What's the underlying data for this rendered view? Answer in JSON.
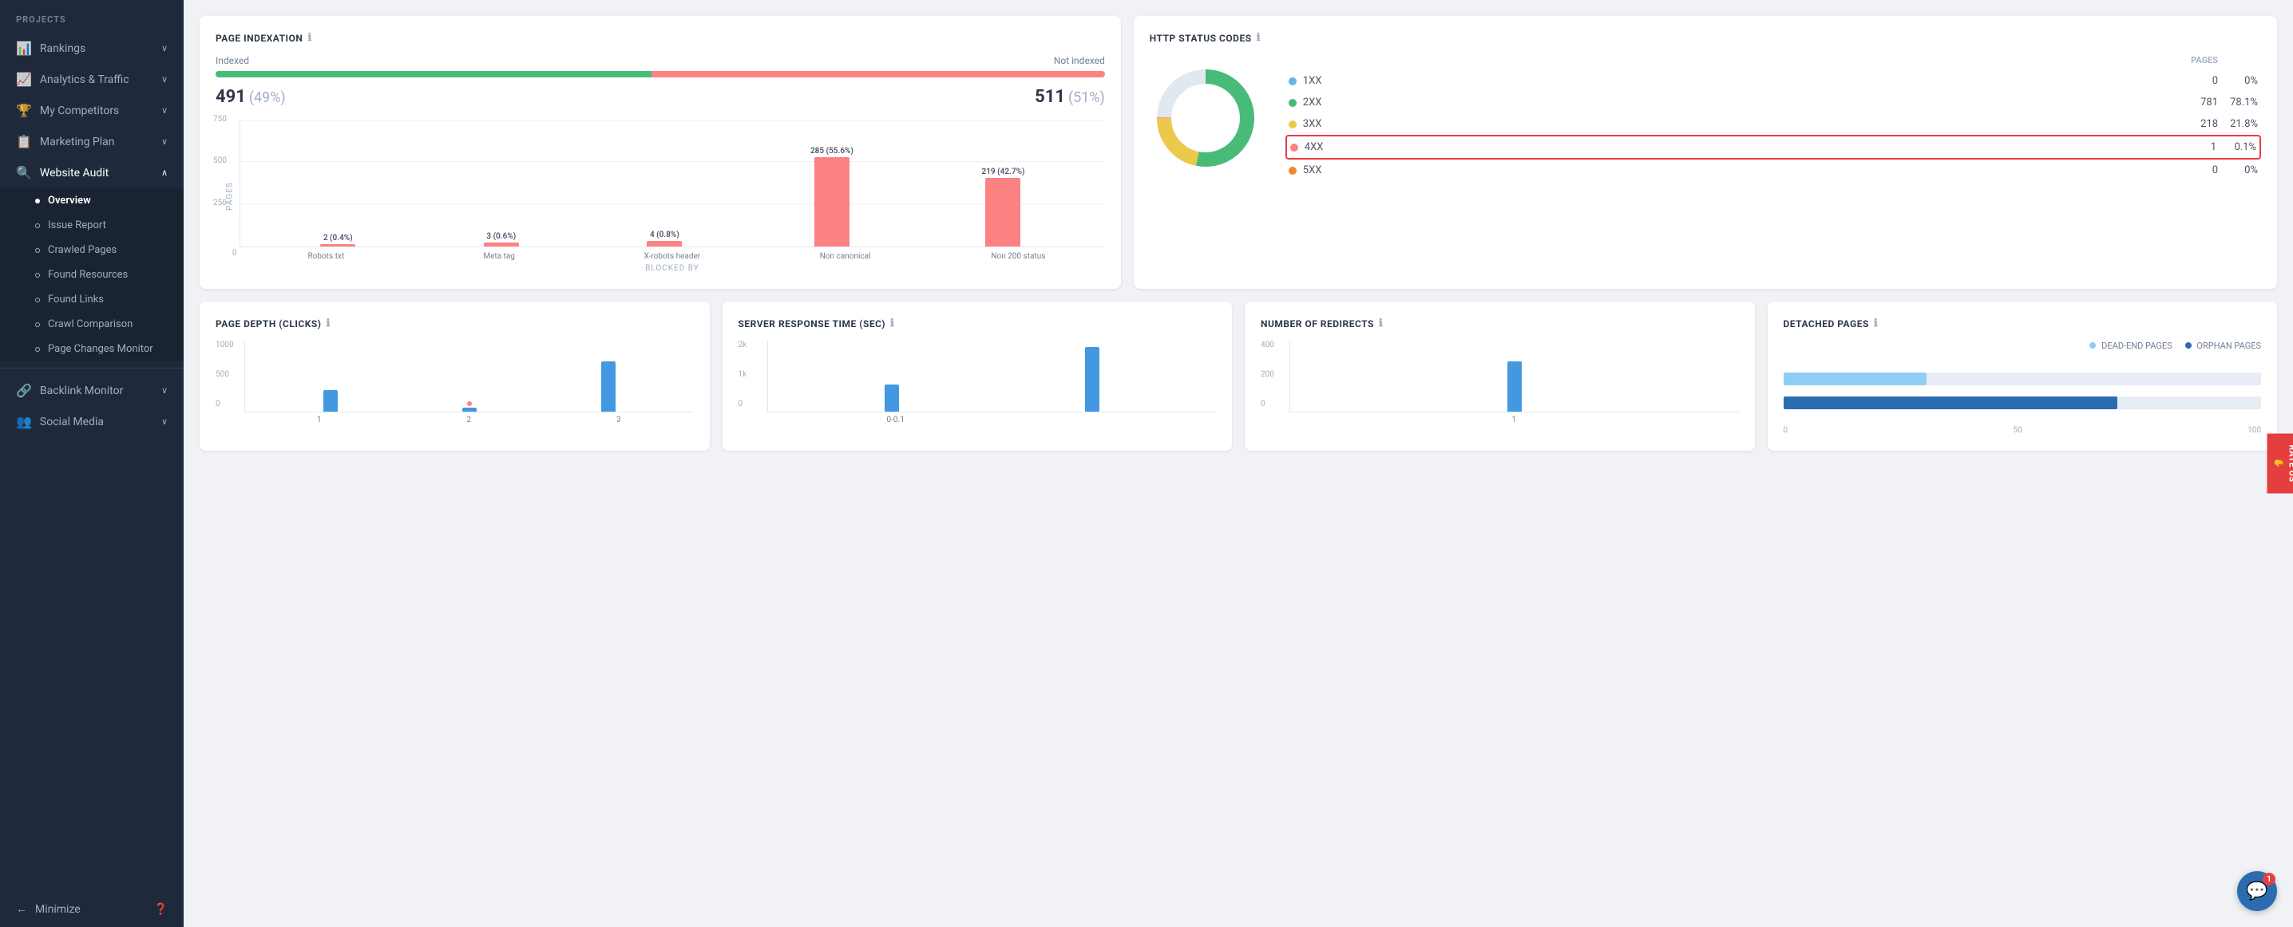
{
  "sidebar": {
    "projects_label": "PROJECTS",
    "items": [
      {
        "id": "rankings",
        "label": "Rankings",
        "icon": "📊",
        "has_chevron": true
      },
      {
        "id": "analytics",
        "label": "Analytics & Traffic",
        "icon": "📈",
        "has_chevron": true
      },
      {
        "id": "competitors",
        "label": "My Competitors",
        "icon": "🏆",
        "has_chevron": true
      },
      {
        "id": "marketing",
        "label": "Marketing Plan",
        "icon": "📋",
        "has_chevron": true
      },
      {
        "id": "website-audit",
        "label": "Website Audit",
        "icon": "🔍",
        "has_chevron": true,
        "active": true
      }
    ],
    "website_audit_subitems": [
      {
        "id": "overview",
        "label": "Overview",
        "active": true
      },
      {
        "id": "issue-report",
        "label": "Issue Report"
      },
      {
        "id": "crawled-pages",
        "label": "Crawled Pages"
      },
      {
        "id": "found-resources",
        "label": "Found Resources"
      },
      {
        "id": "found-links",
        "label": "Found Links"
      },
      {
        "id": "crawl-comparison",
        "label": "Crawl Comparison"
      },
      {
        "id": "page-changes",
        "label": "Page Changes Monitor"
      }
    ],
    "other_items": [
      {
        "id": "backlink",
        "label": "Backlink Monitor",
        "icon": "🔗",
        "has_chevron": true
      },
      {
        "id": "social",
        "label": "Social Media",
        "icon": "👥",
        "has_chevron": true
      }
    ],
    "minimize_label": "Minimize",
    "help_icon": "❓"
  },
  "page_indexation": {
    "title": "PAGE INDEXATION",
    "info_icon": "ℹ",
    "indexed_label": "Indexed",
    "not_indexed_label": "Not indexed",
    "indexed_count": "491",
    "indexed_pct": "(49%)",
    "not_indexed_count": "511",
    "not_indexed_pct": "(51%)",
    "green_pct": 49,
    "red_pct": 51,
    "y_labels": [
      "750",
      "500",
      "250",
      "0"
    ],
    "bars": [
      {
        "label": "Robots.txt",
        "value": "2 (0.4%)",
        "height_pct": 2
      },
      {
        "label": "Meta tag",
        "value": "3 (0.6%)",
        "height_pct": 3
      },
      {
        "label": "X-robots header",
        "value": "4 (0.8%)",
        "height_pct": 4
      },
      {
        "label": "Non canonical",
        "value": "285 (55.6%)",
        "height_pct": 75
      },
      {
        "label": "Non 200 status",
        "value": "219 (42.7%)",
        "height_pct": 57
      }
    ],
    "x_axis_title": "BLOCKED BY",
    "y_axis_title": "PAGES"
  },
  "http_status": {
    "title": "HTTP STATUS CODES",
    "info_icon": "ℹ",
    "pages_label": "PAGES",
    "rows": [
      {
        "code": "1XX",
        "color": "#63b3ed",
        "count": "0",
        "pct": "0%"
      },
      {
        "code": "2XX",
        "color": "#48bb78",
        "count": "781",
        "pct": "78.1%"
      },
      {
        "code": "3XX",
        "color": "#ecc94b",
        "count": "218",
        "pct": "21.8%"
      },
      {
        "code": "4XX",
        "color": "#fc8181",
        "count": "1",
        "pct": "0.1%",
        "highlight": true
      },
      {
        "code": "5XX",
        "color": "#ed8936",
        "count": "0",
        "pct": "0%"
      }
    ],
    "donut": {
      "green_pct": 78.1,
      "yellow_pct": 21.8,
      "red_pct": 0.1
    }
  },
  "page_depth": {
    "title": "PAGE DEPTH (CLICKS)",
    "info_icon": "ℹ",
    "y_labels": [
      "1000",
      "500",
      "0"
    ],
    "bars": [
      {
        "label": "1",
        "height_pct": 30,
        "has_dot": false
      },
      {
        "label": "2",
        "height_pct": 5,
        "has_dot": true
      },
      {
        "label": "3",
        "height_pct": 70,
        "has_dot": false
      }
    ]
  },
  "server_response": {
    "title": "SERVER RESPONSE TIME (SEC)",
    "info_icon": "ℹ",
    "y_labels": [
      "2k",
      "1k",
      "0"
    ],
    "bars": [
      {
        "label": "0-0.1",
        "height_pct": 38,
        "has_dot": false
      },
      {
        "label": "",
        "height_pct": 90,
        "has_dot": false
      }
    ]
  },
  "redirects": {
    "title": "NUMBER OF REDIRECTS",
    "info_icon": "ℹ",
    "y_labels": [
      "400",
      "200",
      "0"
    ],
    "bars": [
      {
        "label": "1",
        "height_pct": 70
      }
    ]
  },
  "detached_pages": {
    "title": "DETACHED PAGES",
    "info_icon": "ℹ",
    "legend": [
      {
        "label": "DEAD-END PAGES",
        "color": "#90cdf4"
      },
      {
        "label": "ORPHAN PAGES",
        "color": "#2b6cb0"
      }
    ],
    "x_labels": [
      "0",
      "50",
      "100"
    ],
    "deadend_pct": 30,
    "orphan_pct": 70
  },
  "rate_us": {
    "label": "RATE US",
    "icon": "✋"
  },
  "chat": {
    "badge": "1"
  }
}
